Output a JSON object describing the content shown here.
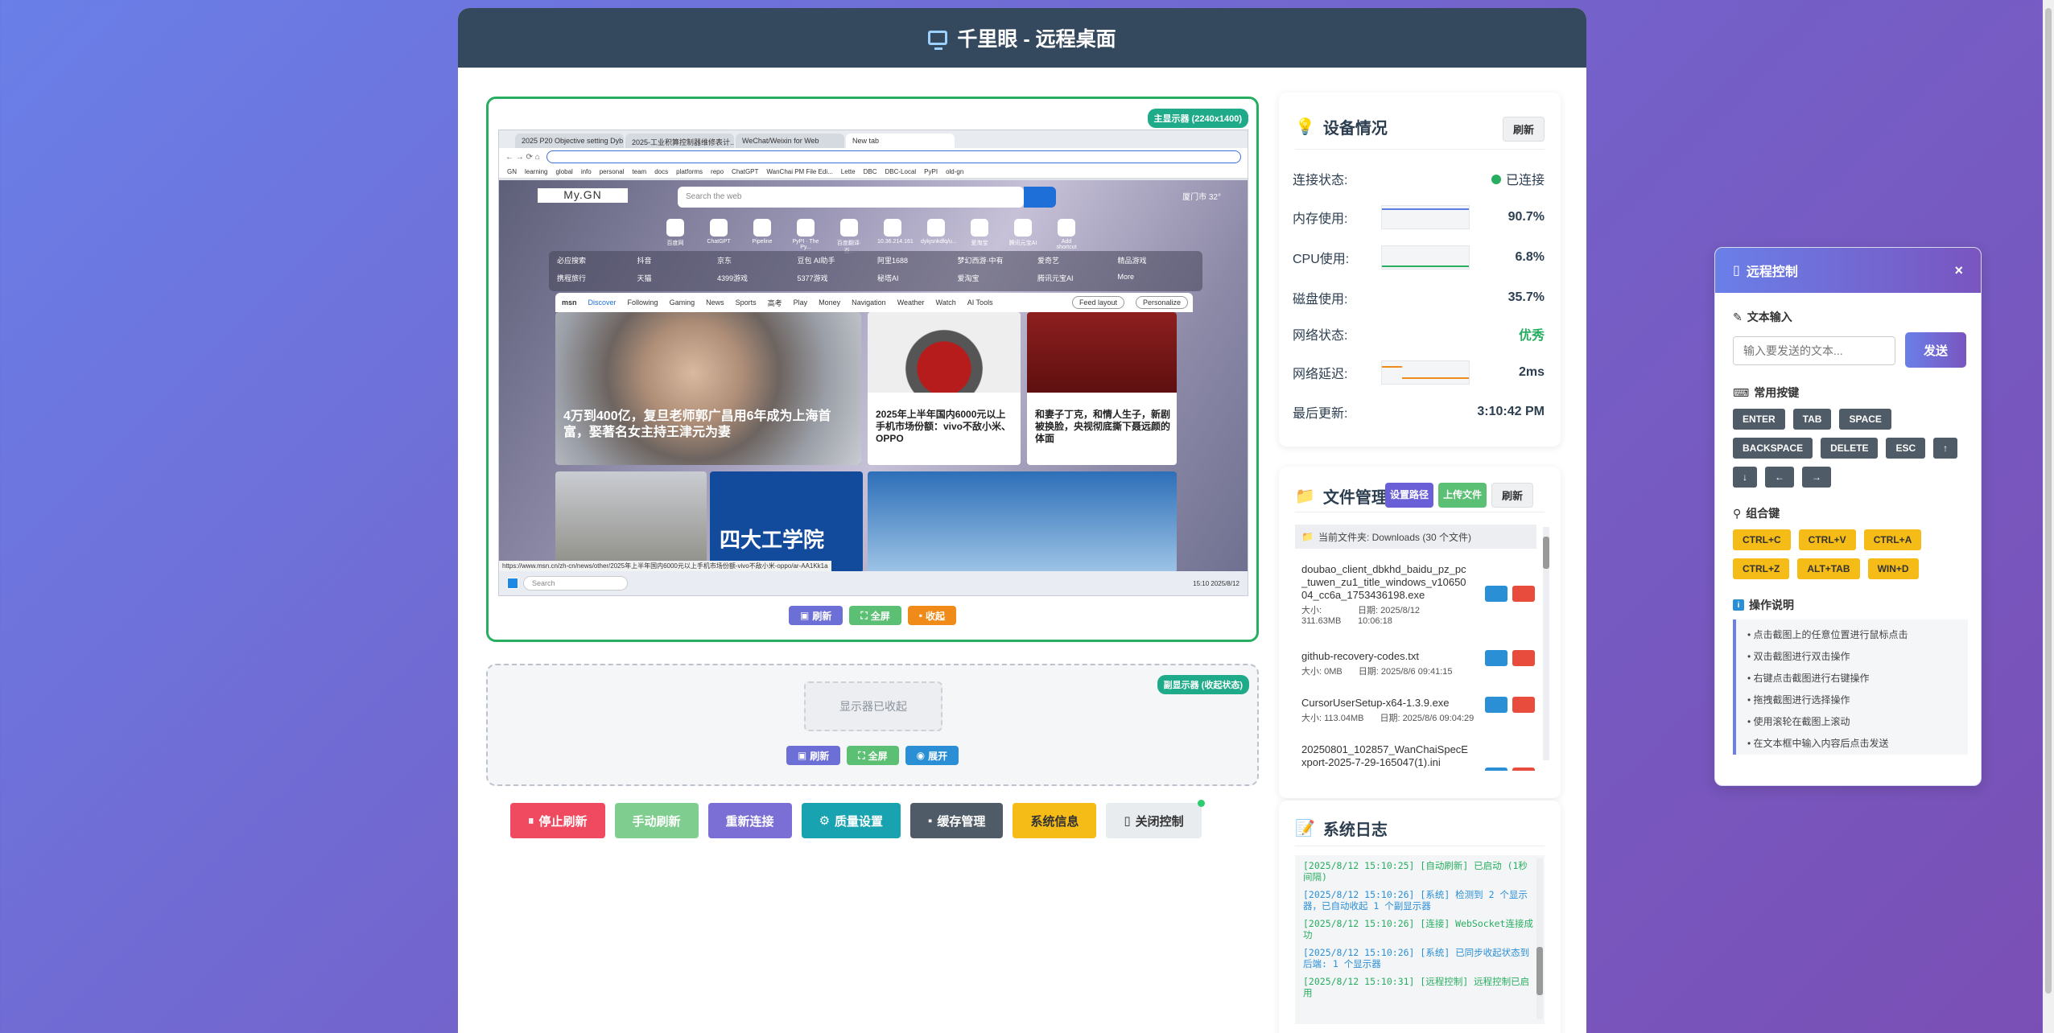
{
  "header": {
    "title": "千里眼 - 远程桌面"
  },
  "display1": {
    "badge": "主显示器 (2240x1400)",
    "browser": {
      "tabs": [
        "2025 P20 Objective setting Dyb...",
        "2025-工业积算控制器维修表计...",
        "WeChat/Weixin for Web",
        "New tab"
      ],
      "bookmarks": [
        "GN",
        "learning",
        "global",
        "info",
        "personal",
        "team",
        "docs",
        "platforms",
        "repo",
        "ChatGPT",
        "WanChai PM File Edi...",
        "Lette",
        "DBC",
        "DBC-Local",
        "PyPI",
        "old-gn"
      ],
      "mygn": "My.GN",
      "search_placeholder": "Search the web",
      "weather": "厦门市  32°",
      "shortcuts": [
        "百度网",
        "ChatGPT",
        "Pipeline",
        "PyPI · The Py...",
        "百度翻译·百...",
        "10.36.214.161",
        "dykjsnkdfq/u...",
        "爱淘宝",
        "腾讯元宝AI",
        "Add shortcut"
      ],
      "quicklinks": [
        "必应搜索",
        "抖音",
        "京东",
        "豆包 AI助手",
        "阿里1688",
        "梦幻西游·中有",
        "爱奇艺",
        "精品游戏",
        "携程旅行",
        "天猫",
        "4399游戏",
        "5377游戏",
        "秘塔AI",
        "爱淘宝",
        "腾讯元宝AI",
        "More"
      ],
      "msn_tabs": [
        "Discover",
        "Following",
        "Gaming",
        "News",
        "Sports",
        "高考",
        "Play",
        "Money",
        "Navigation",
        "Weather",
        "Watch",
        "AI Tools"
      ],
      "feed_layout": "Feed layout",
      "personalize": "Personalize",
      "card1_title": "4万到400亿，复旦老师郭广昌用6年成为上海首富，娶著名女主持王津元为妻",
      "card2_title": "2025年上半年国内6000元以上手机市场份额：vivo不敌小米、OPPO",
      "card3_title": "和妻子丁克，和情人生子，新剧被换脸，央视彻底撕下聂远颜的体面",
      "card4_title": "四大工学院",
      "status_url": "https://www.msn.cn/zh-cn/news/other/2025年上半年国内6000元以上手机市场份额-vivo不敌小米-oppo/ar-AA1Kk1a",
      "taskbar_search": "Search",
      "clock": "15:10 2025/8/12"
    },
    "btn_refresh": "刷新",
    "btn_full": "全屏",
    "btn_collapse": "收起"
  },
  "display2": {
    "badge": "副显示器 (收起状态)",
    "collapsed_text": "显示器已收起",
    "btn_refresh": "刷新",
    "btn_full": "全屏",
    "btn_expand": "展开"
  },
  "bottom": {
    "stop": "停止刷新",
    "manual": "手动刷新",
    "reconnect": "重新连接",
    "quality": "质量设置",
    "cache": "缓存管理",
    "sysinfo": "系统信息",
    "close": "关闭控制"
  },
  "device": {
    "title": "设备情况",
    "refresh": "刷新",
    "rows": [
      {
        "label": "连接状态:",
        "value": "已连接"
      },
      {
        "label": "内存使用:",
        "value": "90.7%"
      },
      {
        "label": "CPU使用:",
        "value": "6.8%"
      },
      {
        "label": "磁盘使用:",
        "value": "35.7%"
      },
      {
        "label": "网络状态:",
        "value": "优秀"
      },
      {
        "label": "网络延迟:",
        "value": "2ms"
      },
      {
        "label": "最后更新:",
        "value": "3:10:42 PM"
      }
    ],
    "colors": {
      "ok": "#27ae60"
    }
  },
  "files": {
    "title": "文件管理",
    "set_path": "设置路径",
    "upload": "上传文件",
    "refresh": "刷新",
    "current": "当前文件夹: Downloads (30 个文件)",
    "items": [
      {
        "name": "doubao_client_dbkhd_baidu_pz_pc_tuwen_zu1_title_windows_v1065004_cc6a_1753436198.exe",
        "size": "大小: 311.63MB",
        "date": "日期: 2025/8/12 10:06:18"
      },
      {
        "name": "github-recovery-codes.txt",
        "size": "大小: 0MB",
        "date": "日期: 2025/8/6 09:41:15"
      },
      {
        "name": "CursorUserSetup-x64-1.3.9.exe",
        "size": "大小: 113.04MB",
        "date": "日期: 2025/8/6 09:04:29"
      },
      {
        "name": "20250801_102857_WanChaiSpecExport-2025-7-29-165047(1).ini",
        "size": "",
        "date": ""
      }
    ]
  },
  "logs": {
    "title": "系统日志",
    "entries": [
      "[2025/8/12 15:10:25] [自动刷新] 已启动 (1秒间隔)",
      "[2025/8/12 15:10:26] [系统] 检测到 2 个显示器，已自动收起 1 个副显示器",
      "[2025/8/12 15:10:26] [连接] WebSocket连接成功",
      "[2025/8/12 15:10:26] [系统] 已同步收起状态到后端: 1 个显示器",
      "[2025/8/12 15:10:31] [远程控制] 远程控制已启用"
    ]
  },
  "remote": {
    "title": "远程控制",
    "close": "×",
    "text_input_label": "文本输入",
    "input_placeholder": "输入要发送的文本...",
    "send": "发送",
    "common_keys_label": "常用按键",
    "keys": [
      "ENTER",
      "TAB",
      "SPACE",
      "BACKSPACE",
      "DELETE",
      "ESC",
      "↑",
      "↓",
      "←",
      "→"
    ],
    "combo_label": "组合键",
    "combos": [
      "CTRL+C",
      "CTRL+V",
      "CTRL+A",
      "CTRL+Z",
      "ALT+TAB",
      "WIN+D"
    ],
    "help_label": "操作说明",
    "help": [
      "点击截图上的任意位置进行鼠标点击",
      "双击截图进行双击操作",
      "右键点击截图进行右键操作",
      "拖拽截图进行选择操作",
      "使用滚轮在截图上滚动",
      "在文本框中输入内容后点击发送"
    ]
  }
}
